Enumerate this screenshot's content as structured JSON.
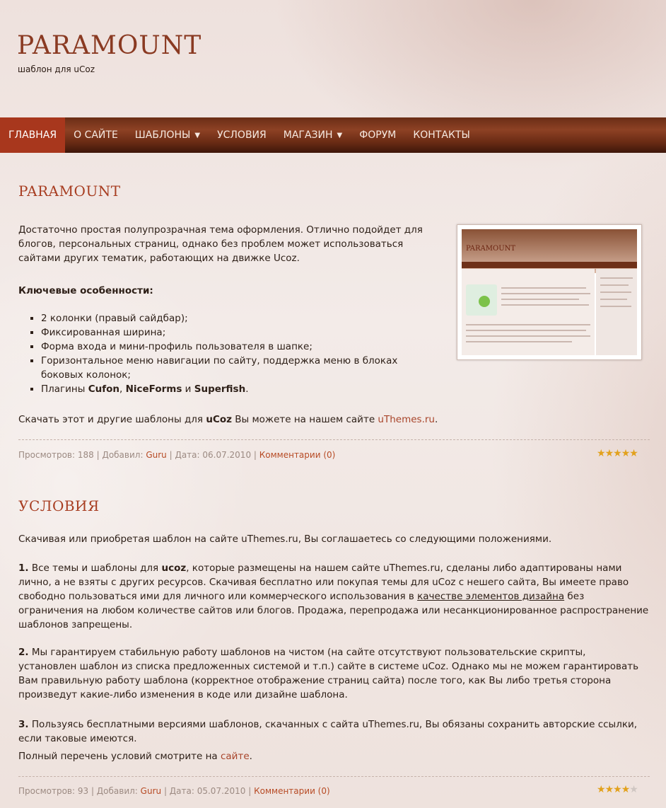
{
  "header": {
    "logo": "PARAMOUNT",
    "slogan": "шаблон для uCoz"
  },
  "nav": {
    "items": [
      {
        "label": "ГЛАВНАЯ",
        "active": true,
        "dropdown": false
      },
      {
        "label": "О САЙТЕ",
        "active": false,
        "dropdown": false
      },
      {
        "label": "ШАБЛОНЫ",
        "active": false,
        "dropdown": true
      },
      {
        "label": "УСЛОВИЯ",
        "active": false,
        "dropdown": false
      },
      {
        "label": "МАГАЗИН",
        "active": false,
        "dropdown": true
      },
      {
        "label": "ФОРУМ",
        "active": false,
        "dropdown": false
      },
      {
        "label": "КОНТАКТЫ",
        "active": false,
        "dropdown": false
      }
    ]
  },
  "post1": {
    "title": "PARAMOUNT",
    "intro": "Достаточно простая полупрозрачная тема оформления. Отлично подойдет для блогов, персональных страниц, однако без проблем может использоваться сайтами других тематик, работающих на движке Ucoz.",
    "features_heading": "Ключевые особенности:",
    "features": [
      "2 колонки (правый сайдбар);",
      "Фиксированная ширина;",
      "Форма входа и мини-профиль пользователя в шапке;",
      "Горизонтальное меню навигации по сайту, поддержка меню в блоках боковых колонок;"
    ],
    "plugins": {
      "prefix": "Плагины ",
      "p1": "Cufon",
      "sep1": ", ",
      "p2": "NiceForms",
      "sep2": " и ",
      "p3": "Superfish",
      "suffix": "."
    },
    "download": {
      "prefix": "Скачать этот и другие шаблоны для ",
      "bold": "uCoz",
      "middle": " Вы можете на нашем сайте ",
      "link": "uThemes.ru",
      "suffix": "."
    },
    "screenshot": {
      "logo": "PARAMOUNT"
    },
    "meta": {
      "views": "Просмотров: 188",
      "sep": " | ",
      "added_label": "Добавил: ",
      "author": "Guru",
      "date": "Дата: 06.07.2010",
      "comments": "Комментарии (0)"
    },
    "rating": 5
  },
  "post2": {
    "title": "УСЛОВИЯ",
    "intro": "Скачивая или приобретая шаблон на сайте uThemes.ru, Вы соглашаетесь со следующими положениями.",
    "p1": {
      "num": "1.",
      "a": " Все темы и шаблоны для ",
      "bold": "ucoz",
      "b": ", которые размещены на нашем сайте uThemes.ru, сделаны либо адаптированы нами лично, а не взяты с других ресурсов. Скачивая бесплатно или покупая темы для uCoz с нешего сайта, Вы имеете право свободно пользоваться ими для личного или коммерческого использования в ",
      "link": "качестве элементов дизайна",
      "c": " без ограничения на любом количестве сайтов или блогов. Продажа, перепродажа или несанкционированное распространение шаблонов запрещены."
    },
    "p2": {
      "num": "2.",
      "text": " Мы гарантируем стабильную работу шаблонов на чистом (на сайте отсутствуют пользовательские скрипты, установлен шаблон из списка предложенных системой и т.п.) сайте в системе uCoz. Однако мы не можем гарантировать Вам правильную работу шаблона (корректное отображение страниц сайта) после того, как Вы либо третья сторона произведут какие-либо изменения в коде или дизайне шаблона."
    },
    "p3": {
      "num": "3.",
      "text": " Пользуясь бесплатными версиями шаблонов, скачанных с сайта uThemes.ru, Вы обязаны сохранить авторские ссылки, если таковые имеются."
    },
    "full": {
      "prefix": "Полный перечень условий смотрите на ",
      "link": "сайте",
      "suffix": "."
    },
    "meta": {
      "views": "Просмотров: 93",
      "sep": " | ",
      "added_label": "Добавил: ",
      "author": "Guru",
      "date": "Дата: 05.07.2010",
      "comments": "Комментарии (0)"
    },
    "rating": 4.5
  },
  "colors": {
    "accent": "#a83e22",
    "nav_bg": "#7a3a1e",
    "nav_active": "#a8371d",
    "star": "#e2a11c"
  }
}
